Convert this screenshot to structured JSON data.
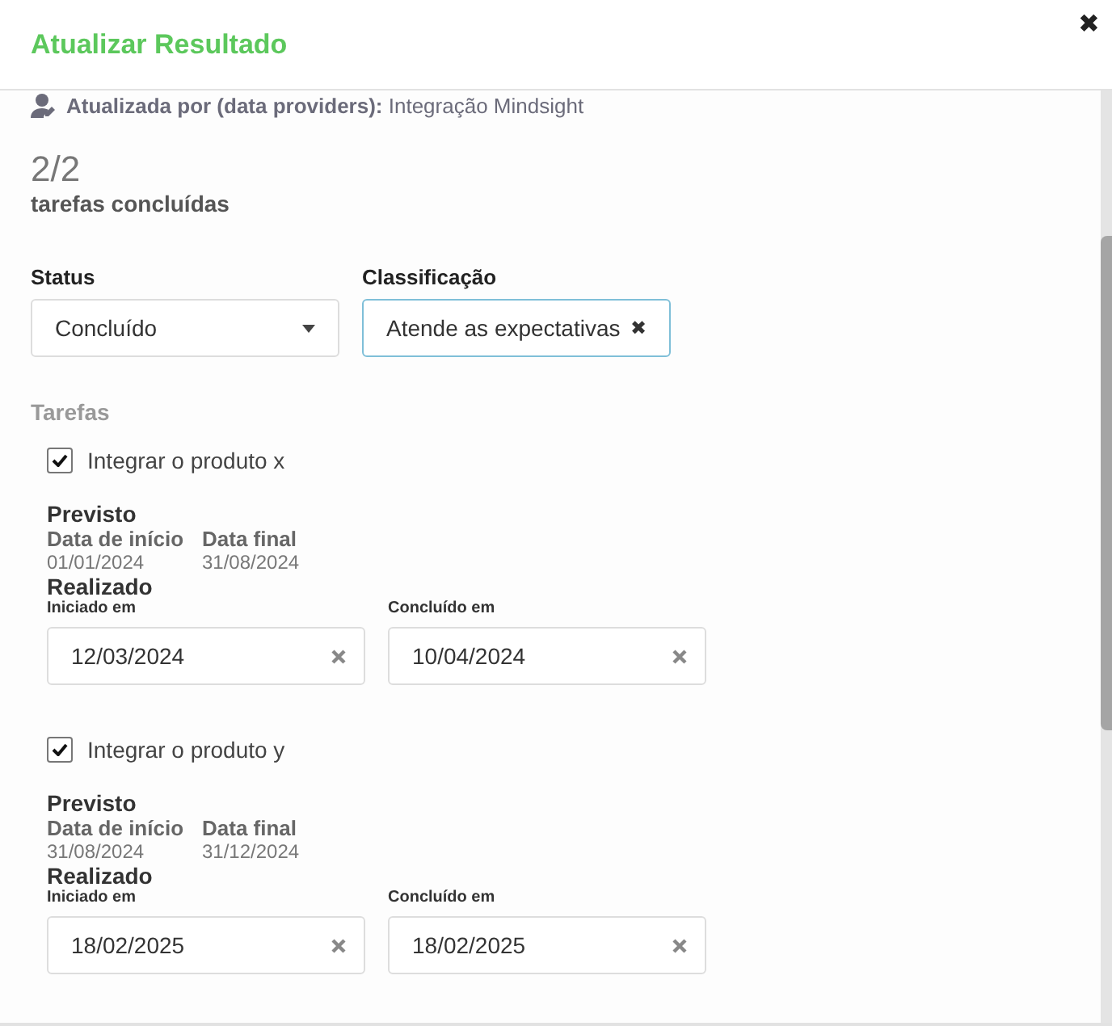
{
  "header": {
    "title": "Atualizar Resultado",
    "close": "✖"
  },
  "updated_by": {
    "label": "Atualizada por (data providers):",
    "value": "Integração Mindsight"
  },
  "progress": {
    "count": "2/2",
    "label": "tarefas concluídas"
  },
  "status": {
    "label": "Status",
    "value": "Concluído"
  },
  "classification": {
    "label": "Classificação",
    "value": "Atende as expectativas",
    "clear": "✖"
  },
  "tasks_label": "Tarefas",
  "tasks": [
    {
      "name": "Integrar o produto x",
      "checked": true,
      "planned_label": "Previsto",
      "start_label": "Data de início",
      "end_label": "Data final",
      "start": "01/01/2024",
      "end": "31/08/2024",
      "done_label": "Realizado",
      "started_label": "Iniciado em",
      "started": "12/03/2024",
      "finished_label": "Concluído em",
      "finished": "10/04/2024"
    },
    {
      "name": "Integrar o produto y",
      "checked": true,
      "planned_label": "Previsto",
      "start_label": "Data de início",
      "end_label": "Data final",
      "start": "31/08/2024",
      "end": "31/12/2024",
      "done_label": "Realizado",
      "started_label": "Iniciado em",
      "started": "18/02/2025",
      "finished_label": "Concluído em",
      "finished": "18/02/2025"
    }
  ]
}
